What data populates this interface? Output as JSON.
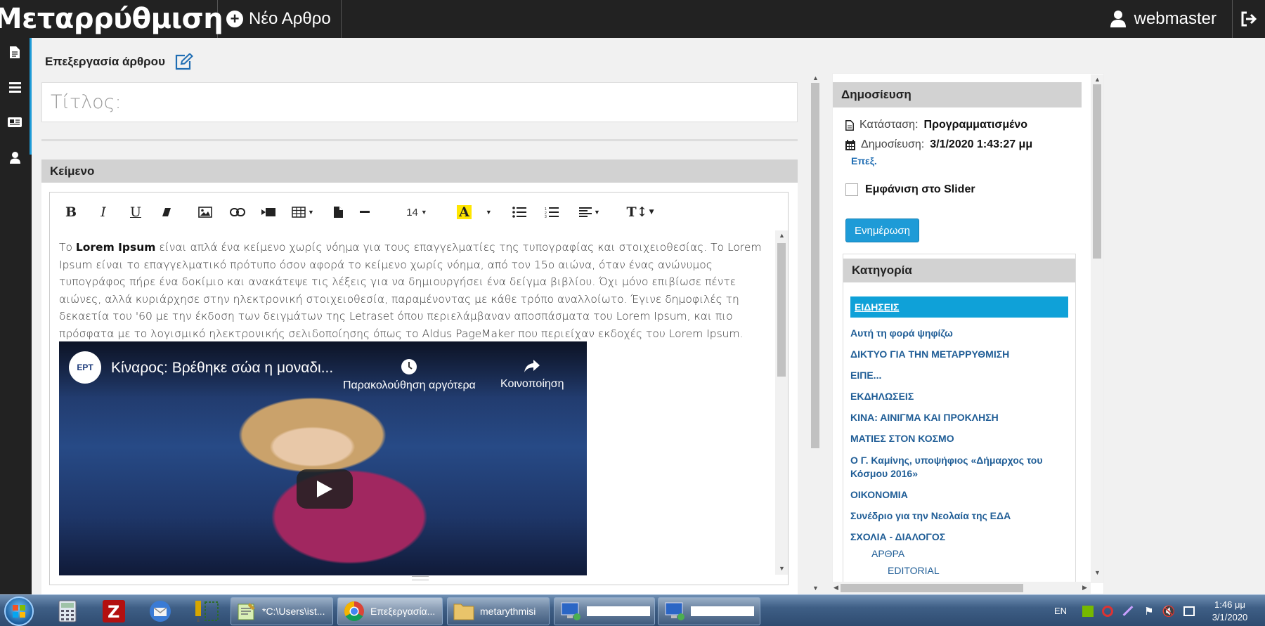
{
  "topbar": {
    "brand": "Μεταρρύθμιση",
    "new_post": "Νέο Αρθρο",
    "user": "webmaster"
  },
  "editor": {
    "heading": "Επεξεργασία άρθρου",
    "title_placeholder": "Τίτλος:",
    "panel_title": "Κείμενο",
    "font_size": "14",
    "body_before": "Το ",
    "body_bold": "Lorem Ipsum",
    "body_after": " είναι απλά ένα κείμενο χωρίς νόημα για τους επαγγελματίες της τυπογραφίας και στοιχειοθεσίας. Το Lorem Ipsum είναι το επαγγελματικό πρότυπο όσον αφορά το κείμενο χωρίς νόημα, από τον 15ο αιώνα, όταν ένας ανώνυμος τυπογράφος πήρε ένα δοκίμιο και ανακάτεψε τις λέξεις για να δημιουργήσει ένα δείγμα βιβλίου. Όχι μόνο επιβίωσε πέντε αιώνες, αλλά κυριάρχησε στην ηλεκτρονική στοιχειοθεσία, παραμένοντας με κάθε τρόπο αναλλοίωτο. Έγινε δημοφιλές τη δεκαετία του '60 με την έκδοση των δειγμάτων της Letraset όπου περιελάμβαναν αποσπάσματα του Lorem Ipsum, και πιο πρόσφατα με το λογισμικό ηλεκτρονικής σελιδοποίησης όπως το Aldus PageMaker που περιείχαν εκδοχές του Lorem Ipsum.",
    "video": {
      "channel": "ΕΡΤ",
      "title": "Κίναρος: Βρέθηκε σώα η μοναδι...",
      "watch_later": "Παρακολούθηση αργότερα",
      "share": "Κοινοποίηση"
    }
  },
  "publish": {
    "title": "Δημοσίευση",
    "status_label": "Κατάσταση:",
    "status_value": "Προγραμματισμένο",
    "date_label": "Δημοσίευση:",
    "date_value": "3/1/2020 1:43:27 μμ",
    "edit_link": "Επεξ.",
    "slider_label": "Εμφάνιση στο Slider",
    "update_button": "Ενημέρωση"
  },
  "category": {
    "title": "Κατηγορία",
    "items": [
      "ΕΙΔΗΣΕΙΣ",
      "Αυτή τη φορά ψηφίζω",
      "ΔΙΚΤΥΟ ΓΙΑ ΤΗΝ ΜΕΤΑΡΡΥΘΜΙΣΗ",
      "ΕΙΠΕ...",
      "ΕΚΔΗΛΩΣΕΙΣ",
      "ΚΙΝΑ: ΑΙΝΙΓΜΑ ΚΑΙ ΠΡΟΚΛΗΣΗ",
      "ΜΑΤΙΕΣ ΣΤΟΝ ΚΟΣΜΟ",
      "Ο Γ. Καμίνης, υποψήφιος «Δήμαρχος του Κόσμου 2016»",
      "ΟΙΚΟΝΟΜΙΑ",
      "Συνέδριο για την Νεολαία της ΕΔΑ",
      "ΣΧΟΛΙΑ - ΔΙΑΛΟΓΟΣ",
      "ΑΡΘΡΑ",
      "EDITORIAL"
    ]
  },
  "taskbar": {
    "tasks": [
      "*C:\\Users\\ist...",
      "Επεξεργασία...",
      "metarythmisi"
    ],
    "lang": "EN",
    "time": "1:46 μμ",
    "date": "3/1/2020"
  },
  "colors": {
    "accent": "#1e9bd7",
    "topbar": "#222222",
    "link": "#1f5d96"
  }
}
